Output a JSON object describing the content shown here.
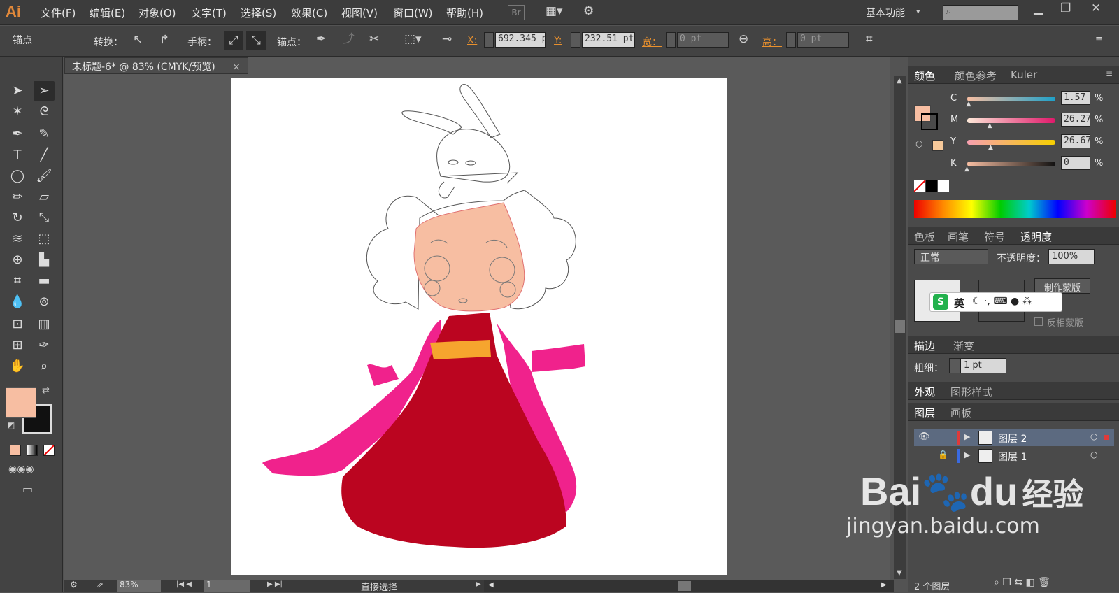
{
  "app": {
    "logo": "Ai"
  },
  "menu": [
    "文件(F)",
    "编辑(E)",
    "对象(O)",
    "文字(T)",
    "选择(S)",
    "效果(C)",
    "视图(V)",
    "窗口(W)",
    "帮助(H)"
  ],
  "menu_extra": {
    "br": "Br",
    "workspace": "基本功能"
  },
  "control": {
    "mode": "锚点",
    "convert": "转换：",
    "handles": "手柄：",
    "anchor": "锚点：",
    "x_label": "X:",
    "x_value": "692.345 p",
    "y_label": "Y:",
    "y_value": "232.51 pt",
    "w_label": "宽：",
    "w_value": "0 pt",
    "h_label": "高：",
    "h_value": "0 pt"
  },
  "document": {
    "tab_title": "未标题-6* @ 83% (CMYK/预览)",
    "close": "×"
  },
  "status": {
    "zoom": "83%",
    "page": "1",
    "tool": "直接选择"
  },
  "color_panel": {
    "tabs": [
      "颜色",
      "颜色参考",
      "Kuler"
    ],
    "channels": [
      {
        "name": "C",
        "value": "1.57",
        "pos": 0.02
      },
      {
        "name": "M",
        "value": "26.27",
        "pos": 0.26
      },
      {
        "name": "Y",
        "value": "26.67",
        "pos": 0.27
      },
      {
        "name": "K",
        "value": "0",
        "pos": 0.0
      }
    ],
    "percent": "%",
    "fill_color": "#f7bea2"
  },
  "transparency_panel": {
    "tabs": [
      "色板",
      "画笔",
      "符号",
      "透明度"
    ],
    "blend_mode": "正常",
    "opacity_label": "不透明度：",
    "opacity_value": "100%",
    "make_mask": "制作蒙版",
    "invert_mask": "反相蒙版"
  },
  "ime": {
    "label": "英"
  },
  "stroke_panel": {
    "tabs": [
      "描边",
      "渐变"
    ],
    "weight_label": "粗细：",
    "weight_value": "1 pt"
  },
  "appearance_panel": {
    "tabs": [
      "外观",
      "图形样式"
    ]
  },
  "layers_panel": {
    "tabs": [
      "图层",
      "画板"
    ],
    "layers": [
      {
        "name": "图层 2",
        "color": "#e03a3a"
      },
      {
        "name": "图层 1",
        "color": "#3a6ae0"
      }
    ],
    "footer": "2 个图层"
  },
  "watermark": {
    "brand_a": "Bai",
    "brand_b": "du",
    "brand_cn": "经验",
    "url": "jingyan.baidu.com"
  }
}
